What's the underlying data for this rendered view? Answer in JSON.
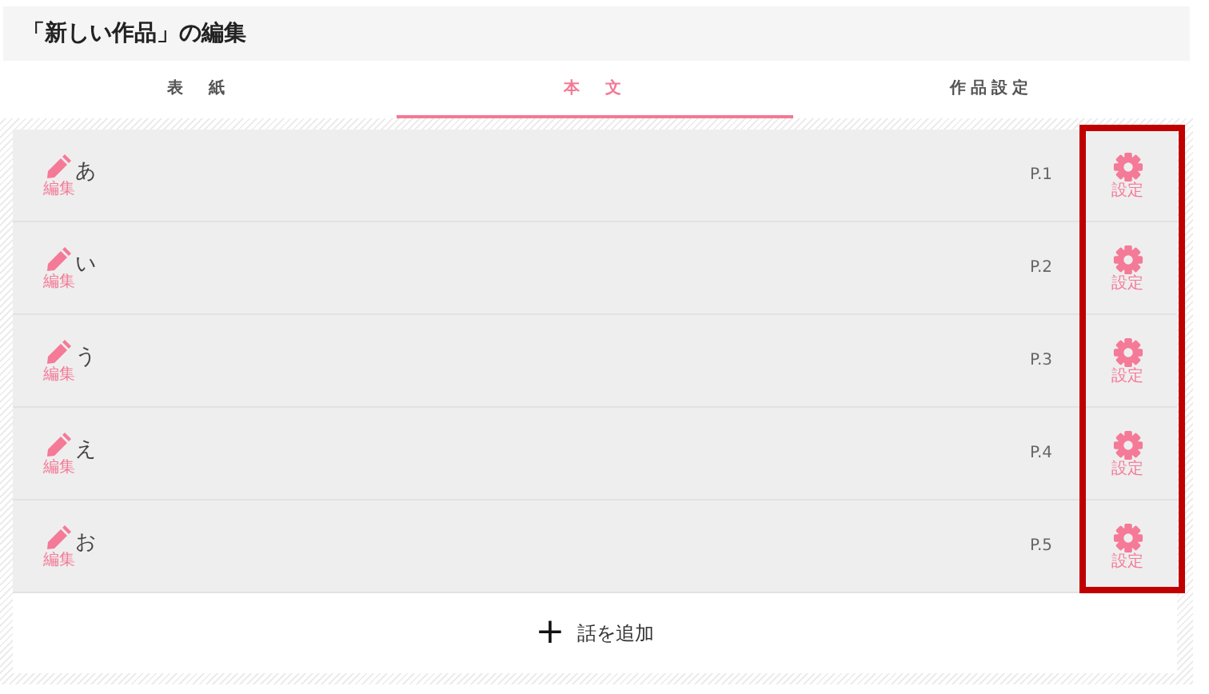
{
  "header": {
    "title": "「新しい作品」の編集"
  },
  "tabs": [
    {
      "label": "表　紙",
      "selected": false
    },
    {
      "label": "本　文",
      "selected": true
    },
    {
      "label": "作品設定",
      "selected": false
    }
  ],
  "episodes": [
    {
      "title": "あ",
      "edit_label": "編集",
      "page": "P.1",
      "settings_label": "設定"
    },
    {
      "title": "い",
      "edit_label": "編集",
      "page": "P.2",
      "settings_label": "設定"
    },
    {
      "title": "う",
      "edit_label": "編集",
      "page": "P.3",
      "settings_label": "設定"
    },
    {
      "title": "え",
      "edit_label": "編集",
      "page": "P.4",
      "settings_label": "設定"
    },
    {
      "title": "お",
      "edit_label": "編集",
      "page": "P.5",
      "settings_label": "設定"
    }
  ],
  "settings_column_highlighted": true,
  "add_button": {
    "icon": "+",
    "label": "話を追加"
  }
}
